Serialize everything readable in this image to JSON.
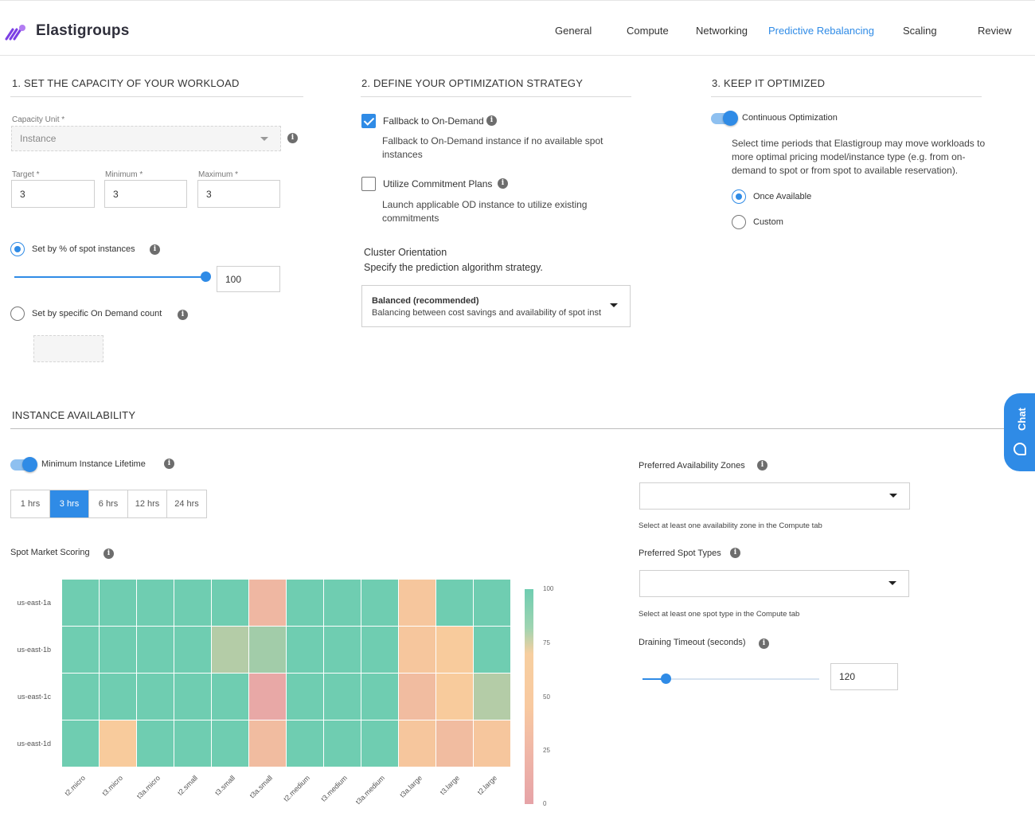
{
  "app": {
    "title": "Elastigroups"
  },
  "nav": {
    "items": [
      "General",
      "Compute",
      "Networking",
      "Predictive Rebalancing",
      "Scaling",
      "Review"
    ],
    "active": "Predictive Rebalancing"
  },
  "capacity": {
    "title": "1. SET THE CAPACITY OF YOUR WORKLOAD",
    "unit_label": "Capacity Unit *",
    "unit_value": "Instance",
    "target_label": "Target *",
    "target_value": "3",
    "min_label": "Minimum *",
    "min_value": "3",
    "max_label": "Maximum *",
    "max_value": "3",
    "spot_pct_label": "Set by % of spot instances",
    "spot_pct_value": "100",
    "spot_pct_selected": true,
    "od_count_label": "Set by specific On Demand count",
    "od_count_selected": false
  },
  "strategy": {
    "title": "2. DEFINE YOUR OPTIMIZATION STRATEGY",
    "fallback_label": "Fallback to On-Demand",
    "fallback_checked": true,
    "fallback_desc_1": "Fallback to On-Demand instance if no available spot",
    "fallback_desc_2": "instances",
    "commit_label": "Utilize Commitment Plans",
    "commit_checked": false,
    "commit_desc_1": "Launch applicable OD instance to utilize existing",
    "commit_desc_2": "commitments",
    "orientation_title": "Cluster Orientation",
    "orientation_subtitle": "Specify the prediction algorithm strategy.",
    "orientation_value": "Balanced (recommended)",
    "orientation_desc": "Balancing between cost savings and availability of spot insta"
  },
  "optimized": {
    "title": "3. KEEP IT OPTIMIZED",
    "toggle_label": "Continuous Optimization",
    "toggle_on": true,
    "desc_1": "Select time periods that Elastigroup may move workloads to",
    "desc_2": "more optimal pricing model/instance type (e.g. from on-",
    "desc_3": "demand to spot or from spot to available reservation).",
    "option_once": "Once Available",
    "option_custom": "Custom",
    "selected": "Once Available"
  },
  "availability": {
    "title": "INSTANCE AVAILABILITY",
    "lifetime_label": "Minimum Instance Lifetime",
    "lifetime_on": true,
    "lifetime_options": [
      "1 hrs",
      "3 hrs",
      "6 hrs",
      "12 hrs",
      "24 hrs"
    ],
    "lifetime_selected": "3 hrs",
    "scoring_label": "Spot Market Scoring",
    "zones_label": "Preferred Availability Zones",
    "zones_hint": "Select at least one availability zone in the Compute tab",
    "spot_types_label": "Preferred Spot Types",
    "spot_types_hint": "Select at least one spot type in the Compute tab",
    "draining_label": "Draining Timeout (seconds)",
    "draining_value": "120"
  },
  "heatmap": {
    "rows": [
      "us-east-1a",
      "us-east-1b",
      "us-east-1c",
      "us-east-1d"
    ],
    "cols": [
      "t2.micro",
      "t3.micro",
      "t3a.micro",
      "t2.small",
      "t3.small",
      "t3a.small",
      "t2.medium",
      "t3.medium",
      "t3a.medium",
      "t3a.large",
      "t3.large",
      "t2.large"
    ],
    "legend_ticks": [
      "100",
      "75",
      "50",
      "25",
      "0"
    ]
  },
  "chart_data": {
    "type": "heatmap",
    "title": "Spot Market Scoring",
    "x": [
      "t2.micro",
      "t3.micro",
      "t3a.micro",
      "t2.small",
      "t3.small",
      "t3a.small",
      "t2.medium",
      "t3.medium",
      "t3a.medium",
      "t3a.large",
      "t3.large",
      "t2.large"
    ],
    "y": [
      "us-east-1a",
      "us-east-1b",
      "us-east-1c",
      "us-east-1d"
    ],
    "values": [
      [
        100,
        100,
        100,
        100,
        100,
        40,
        100,
        100,
        100,
        55,
        100,
        100
      ],
      [
        100,
        100,
        100,
        100,
        80,
        85,
        100,
        100,
        100,
        55,
        60,
        100
      ],
      [
        100,
        100,
        100,
        100,
        100,
        25,
        100,
        100,
        100,
        45,
        60,
        80
      ],
      [
        100,
        60,
        100,
        100,
        100,
        45,
        100,
        100,
        100,
        55,
        45,
        55
      ]
    ],
    "colorbar_range": [
      0,
      100
    ],
    "colors": {
      "high": "#6fcdb1",
      "mid": "#f8cb9c",
      "low": "#e6a3a7"
    }
  },
  "chat": {
    "label": "Chat"
  }
}
